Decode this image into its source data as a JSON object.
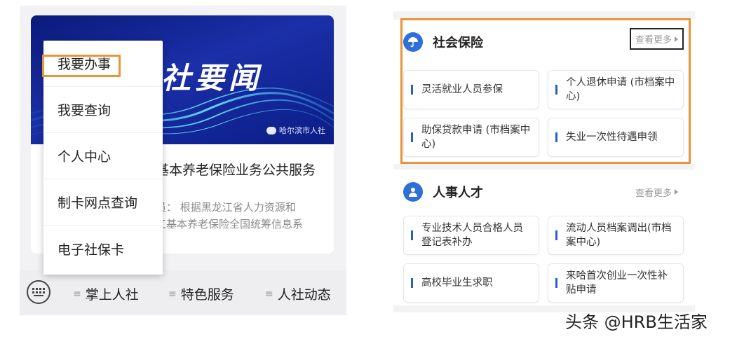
{
  "left": {
    "banner": {
      "title": "社要闻",
      "source": "哈尔滨市人社"
    },
    "article": {
      "title": "基本养老保险业务公共服务",
      "snippet_line1": "员： 根据黑龙江省人力资源和",
      "snippet_line2": "工基本养老保险全国统筹信息系"
    },
    "dropdown": {
      "items": [
        {
          "label": "我要办事"
        },
        {
          "label": "我要查询"
        },
        {
          "label": "个人中心"
        },
        {
          "label": "制卡网点查询"
        },
        {
          "label": "电子社保卡"
        }
      ]
    },
    "bottom_nav": {
      "items": [
        {
          "label": "掌上人社",
          "icon": "menu-icon"
        },
        {
          "label": "特色服务",
          "icon": "menu-icon"
        },
        {
          "label": "人社动态",
          "icon": "menu-icon"
        }
      ]
    }
  },
  "right": {
    "sections": [
      {
        "title": "社会保险",
        "icon": "umbrella-icon",
        "more": "查看更多",
        "tiles": [
          {
            "label": "灵活就业人员参保"
          },
          {
            "label": "个人退休申请 (市档案中心)"
          },
          {
            "label": "助保贷款申请 (市档案中心)"
          },
          {
            "label": "失业一次性待遇申领"
          }
        ]
      },
      {
        "title": "人事人才",
        "icon": "person-icon",
        "more": "查看更多",
        "tiles": [
          {
            "label": "专业技术人员合格人员登记表补办"
          },
          {
            "label": "流动人员档案调出(市档案中心)"
          },
          {
            "label": "高校毕业生求职"
          },
          {
            "label": "来哈首次创业一次性补贴申请"
          }
        ]
      }
    ]
  },
  "watermark": "头条 @HRB生活家",
  "colors": {
    "accent_blue": "#2f6fd8",
    "highlight_orange": "#e8943a",
    "banner_navy": "#0b1d86"
  }
}
